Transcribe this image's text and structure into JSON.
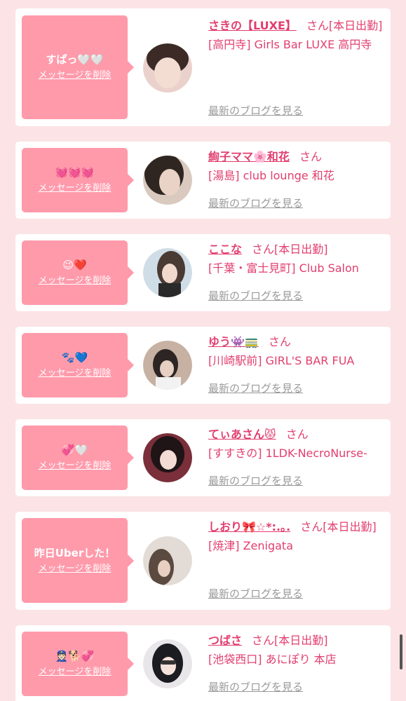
{
  "delete_label": "メッセージを削除",
  "blog_label": "最新のブログを見る",
  "san_label": "さん",
  "items": [
    {
      "message": "すぱっ🤍🤍",
      "name": "さきの【LUXE】",
      "status": "[本日出勤]",
      "shop": "[高円寺] Girls Bar LUXE 高円寺",
      "avatar_colors": [
        "#ead1cc",
        "#3b2a26"
      ]
    },
    {
      "message": "💓💓💓",
      "name": "絢子ママ🌸和花",
      "status": "",
      "shop": "[湯島] club lounge 和花",
      "avatar_colors": [
        "#d9c9bf",
        "#2f2622"
      ]
    },
    {
      "message": "😉❤️",
      "name": "ここな",
      "status": "[本日出勤]",
      "shop": "[千葉・富士見町] Club Salon",
      "avatar_colors": [
        "#cfdde6",
        "#4a3a34"
      ]
    },
    {
      "message": "🐾💙",
      "name": "ゆう👾🚃",
      "status": "",
      "shop": "[川崎駅前] GIRL'S BAR FUA",
      "avatar_colors": [
        "#c7b1a2",
        "#2d2523"
      ]
    },
    {
      "message": "💞🤍",
      "name": "てぃあさん😾",
      "status": "",
      "shop": "[すすきの] 1LDK-NecroNurse-",
      "avatar_colors": [
        "#7a2f3a",
        "#1f1416"
      ]
    },
    {
      "message": "昨日Uberした！",
      "name": "しおり🎀☆*:.｡.",
      "status": "[本日出勤]",
      "shop": "[焼津] Zenigata",
      "avatar_colors": [
        "#e3dcd6",
        "#5b4a40"
      ]
    },
    {
      "message": "👮🏻🐕💞",
      "name": "つばさ",
      "status": "[本日出勤]",
      "shop": "[池袋西口] あにぽり 本店",
      "avatar_colors": [
        "#e9e6ea",
        "#1b1b22"
      ]
    }
  ]
}
